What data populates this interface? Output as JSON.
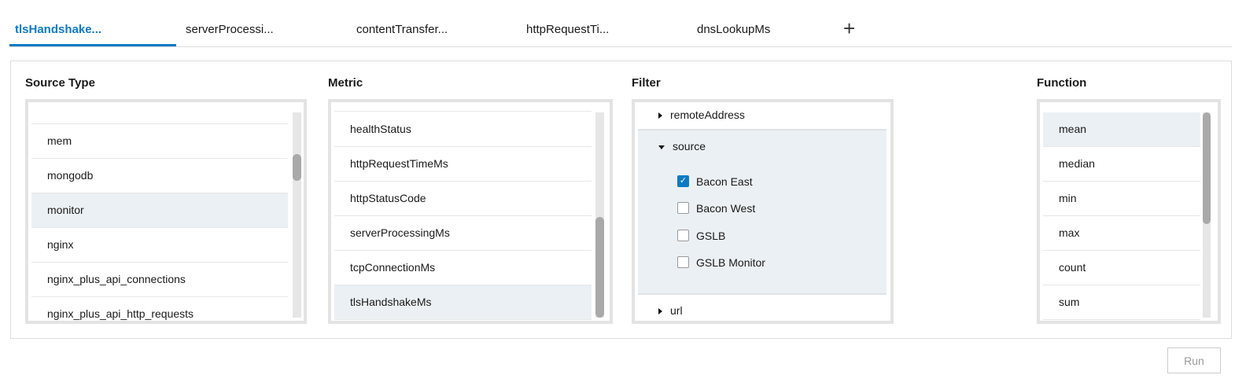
{
  "tabs": [
    {
      "label": "tlsHandshake..."
    },
    {
      "label": "serverProcessi..."
    },
    {
      "label": "contentTransfer..."
    },
    {
      "label": "httpRequestTi..."
    },
    {
      "label": "dnsLookupMs"
    }
  ],
  "add_tab_label": "+",
  "source_type": {
    "heading": "Source Type",
    "items": [
      "mem",
      "mongodb",
      "monitor",
      "nginx",
      "nginx_plus_api_connections",
      "nginx_plus_api_http_requests"
    ],
    "selected": "monitor"
  },
  "metric": {
    "heading": "Metric",
    "items": [
      "healthStatus",
      "httpRequestTimeMs",
      "httpStatusCode",
      "serverProcessingMs",
      "tcpConnectionMs",
      "tlsHandshakeMs"
    ],
    "selected": "tlsHandshakeMs"
  },
  "filter": {
    "heading": "Filter",
    "groups": [
      "remoteAddress",
      "source",
      "url"
    ],
    "options": [
      {
        "label": "Bacon East",
        "checked": true
      },
      {
        "label": "Bacon West",
        "checked": false
      },
      {
        "label": "GSLB",
        "checked": false
      },
      {
        "label": "GSLB Monitor",
        "checked": false
      }
    ]
  },
  "function": {
    "heading": "Function",
    "items": [
      "mean",
      "median",
      "min",
      "max",
      "count",
      "sum"
    ],
    "selected": "mean"
  },
  "run_label": "Run",
  "colors": {
    "accent": "#0b7bc4",
    "selected_row": "#ebf0f4"
  }
}
